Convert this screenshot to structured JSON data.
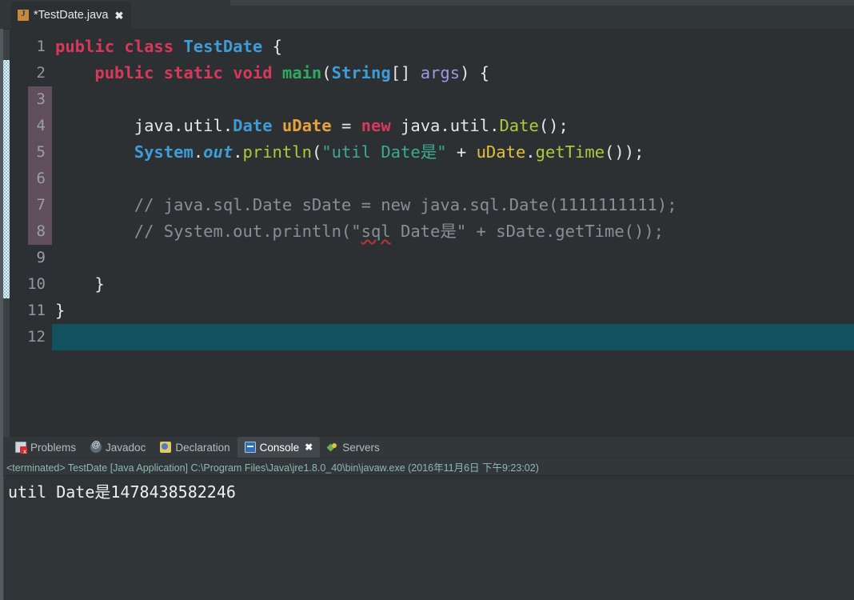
{
  "window": {
    "title": "*TestDate.java"
  },
  "editor_tab": {
    "label": "*TestDate.java",
    "icon": "java-file-icon",
    "close_label": "✖",
    "active": true
  },
  "gutter": {
    "line_numbers": [
      "1",
      "2",
      "3",
      "4",
      "5",
      "6",
      "7",
      "8",
      "9",
      "10",
      "11",
      "12"
    ],
    "fold_marker_line": "2",
    "current_line": "12",
    "change_bar_color": "#88c4ef",
    "block_highlight_color": "#6b5667"
  },
  "code": {
    "language": "Java",
    "current_line_highlight_color": "#11525e",
    "colors": {
      "keyword": "#d8385a",
      "type": "#3e9cd6",
      "method_declaration": "#2eab60",
      "method_invocation": "#aacb3c",
      "local_variable": "#e8a33d",
      "field": "#e3c03c",
      "parameter": "#9a9ae0",
      "string": "#3aab8c",
      "comment": "#8a8f93",
      "plain": "#e6e6e6",
      "background": "#2c3033"
    },
    "lines": [
      {
        "n": "1",
        "text": "public class TestDate {"
      },
      {
        "n": "2",
        "text": "    public static void main(String[] args) {"
      },
      {
        "n": "3",
        "text": ""
      },
      {
        "n": "4",
        "text": "        java.util.Date uDate = new java.util.Date();"
      },
      {
        "n": "5",
        "text": "        System.out.println(\"util Date是\" + uDate.getTime());"
      },
      {
        "n": "6",
        "text": ""
      },
      {
        "n": "7",
        "text": "        // java.sql.Date sDate = new java.sql.Date(1111111111);"
      },
      {
        "n": "8",
        "text": "        // System.out.println(\"sql Date是\" + sDate.getTime());"
      },
      {
        "n": "9",
        "text": ""
      },
      {
        "n": "10",
        "text": "    }"
      },
      {
        "n": "11",
        "text": "}"
      },
      {
        "n": "12",
        "text": ""
      }
    ],
    "tokens": {
      "l1": {
        "kw1": "public",
        "kw2": "class",
        "type": "TestDate",
        "brace": "{"
      },
      "l2": {
        "kw1": "public",
        "kw2": "static",
        "kw3": "void",
        "method": "main",
        "type": "String",
        "brackets": "[]",
        "param": "args",
        "close": ") {",
        "open": "("
      },
      "l4": {
        "pkg": "java.util.",
        "type": "Date",
        "var": "uDate",
        "eq": "=",
        "kw": "new",
        "ctor_pkg": "java.util.",
        "ctor": "Date",
        "tail": "();"
      },
      "l5": {
        "cls": "System",
        "dot1": ".",
        "field": "out",
        "dot2": ".",
        "call": "println",
        "paren": "(",
        "string": "\"util Date是\"",
        "plus": "+",
        "var": "uDate",
        "dot3": ".",
        "call2": "getTime",
        "tail": "());"
      },
      "l7": {
        "comment": "// java.sql.Date sDate = new java.sql.Date(1111111111);"
      },
      "l8": {
        "comment_a": "// System.out.println(\"",
        "misspelled": "sql",
        "comment_b": " Date是\" + sDate.getTime());"
      },
      "l10": {
        "brace": "}"
      },
      "l11": {
        "brace": "}"
      }
    }
  },
  "bottom_panel": {
    "tabs": [
      {
        "label": "Problems",
        "icon": "problems-icon",
        "active": false,
        "closable": false
      },
      {
        "label": "Javadoc",
        "icon": "javadoc-icon",
        "active": false,
        "closable": false
      },
      {
        "label": "Declaration",
        "icon": "declaration-icon",
        "active": false,
        "closable": false
      },
      {
        "label": "Console",
        "icon": "console-icon",
        "active": true,
        "closable": true,
        "close_label": "✖"
      },
      {
        "label": "Servers",
        "icon": "servers-icon",
        "active": false,
        "closable": false
      }
    ],
    "console": {
      "status": "<terminated> TestDate [Java Application] C:\\Program Files\\Java\\jre1.8.0_40\\bin\\javaw.exe (2016年11月6日 下午9:23:02)",
      "status_color": "#8fb9b4",
      "output_lines": [
        "util Date是1478438582246"
      ]
    }
  }
}
